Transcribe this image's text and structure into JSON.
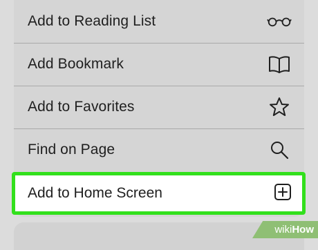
{
  "menu": {
    "items": [
      {
        "label": "Add to Reading List",
        "icon": "glasses-icon"
      },
      {
        "label": "Add Bookmark",
        "icon": "book-icon"
      },
      {
        "label": "Add to Favorites",
        "icon": "star-icon"
      },
      {
        "label": "Find on Page",
        "icon": "magnifier-icon"
      },
      {
        "label": "Add to Home Screen",
        "icon": "plus-square-icon",
        "highlighted": true
      }
    ]
  },
  "colors": {
    "highlight_border": "#32e01c",
    "menu_background": "#d5d5d5",
    "watermark_background": "#8fbf74"
  },
  "watermark": {
    "part1": "wiki",
    "part2": "How"
  }
}
